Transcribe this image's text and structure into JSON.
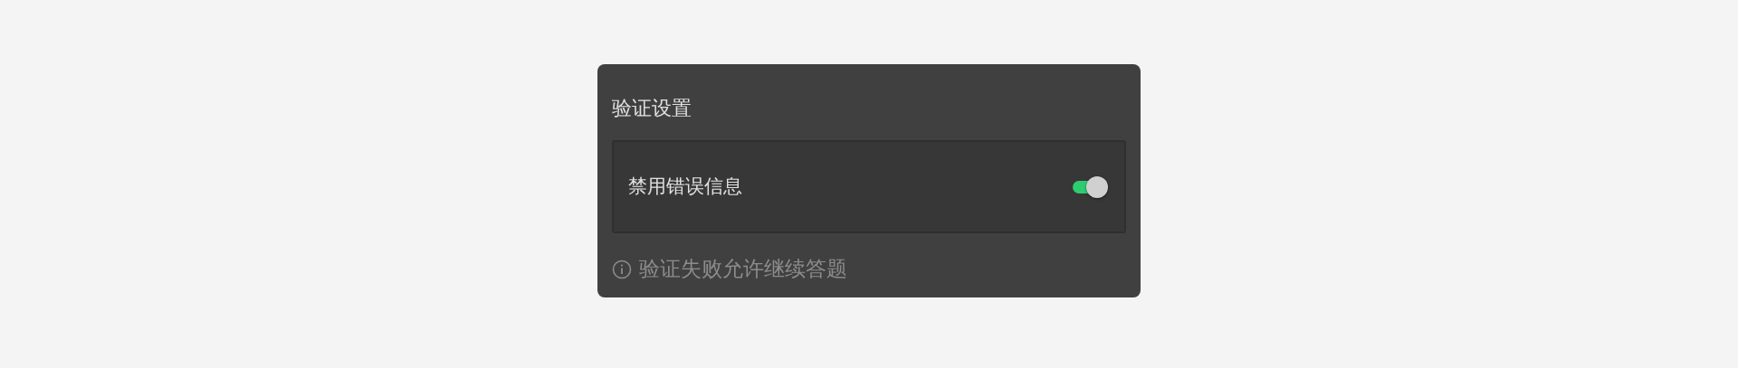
{
  "panel": {
    "title": "验证设置",
    "setting": {
      "label": "禁用错误信息",
      "on": true
    },
    "hint": "验证失败允许继续答题"
  }
}
